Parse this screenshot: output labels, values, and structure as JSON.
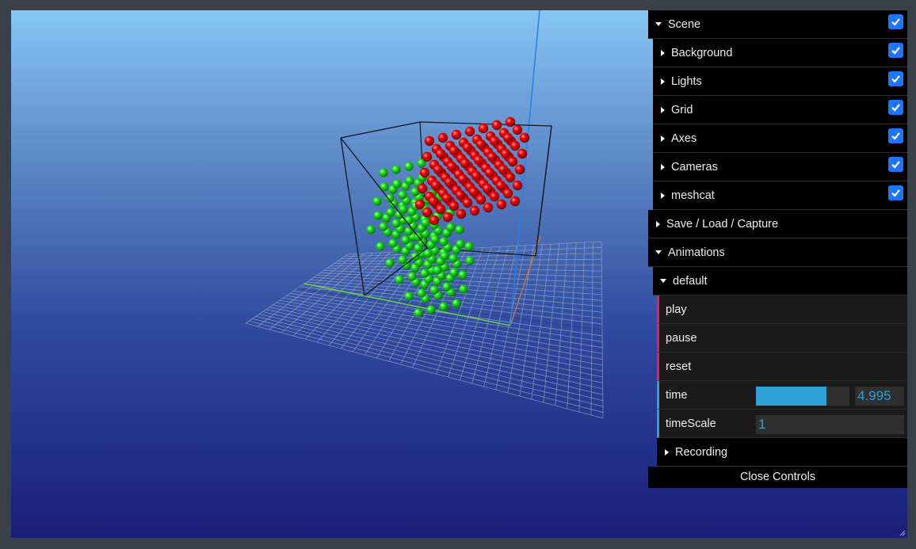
{
  "gui": {
    "scene": {
      "label": "Scene",
      "checked": true
    },
    "scene_children": [
      {
        "label": "Background",
        "checked": true
      },
      {
        "label": "Lights",
        "checked": true
      },
      {
        "label": "Grid",
        "checked": true
      },
      {
        "label": "Axes",
        "checked": true
      },
      {
        "label": "Cameras",
        "checked": true
      },
      {
        "label": "meshcat",
        "checked": true
      }
    ],
    "save_load_capture": {
      "label": "Save / Load / Capture"
    },
    "animations": {
      "label": "Animations",
      "default_folder": "default",
      "play_label": "play",
      "pause_label": "pause",
      "reset_label": "reset",
      "time_label": "time",
      "time_value": "4.995",
      "time_fraction": 0.75,
      "timescale_label": "timeScale",
      "timescale_value": "1",
      "recording_label": "Recording"
    },
    "close_label": "Close Controls"
  },
  "colors": {
    "function_accent": "#e61d5f",
    "number_accent": "#2fa1d6",
    "checkbox": "#1f75fe",
    "sphere_green": "#13d813",
    "sphere_red": "#e60000"
  }
}
